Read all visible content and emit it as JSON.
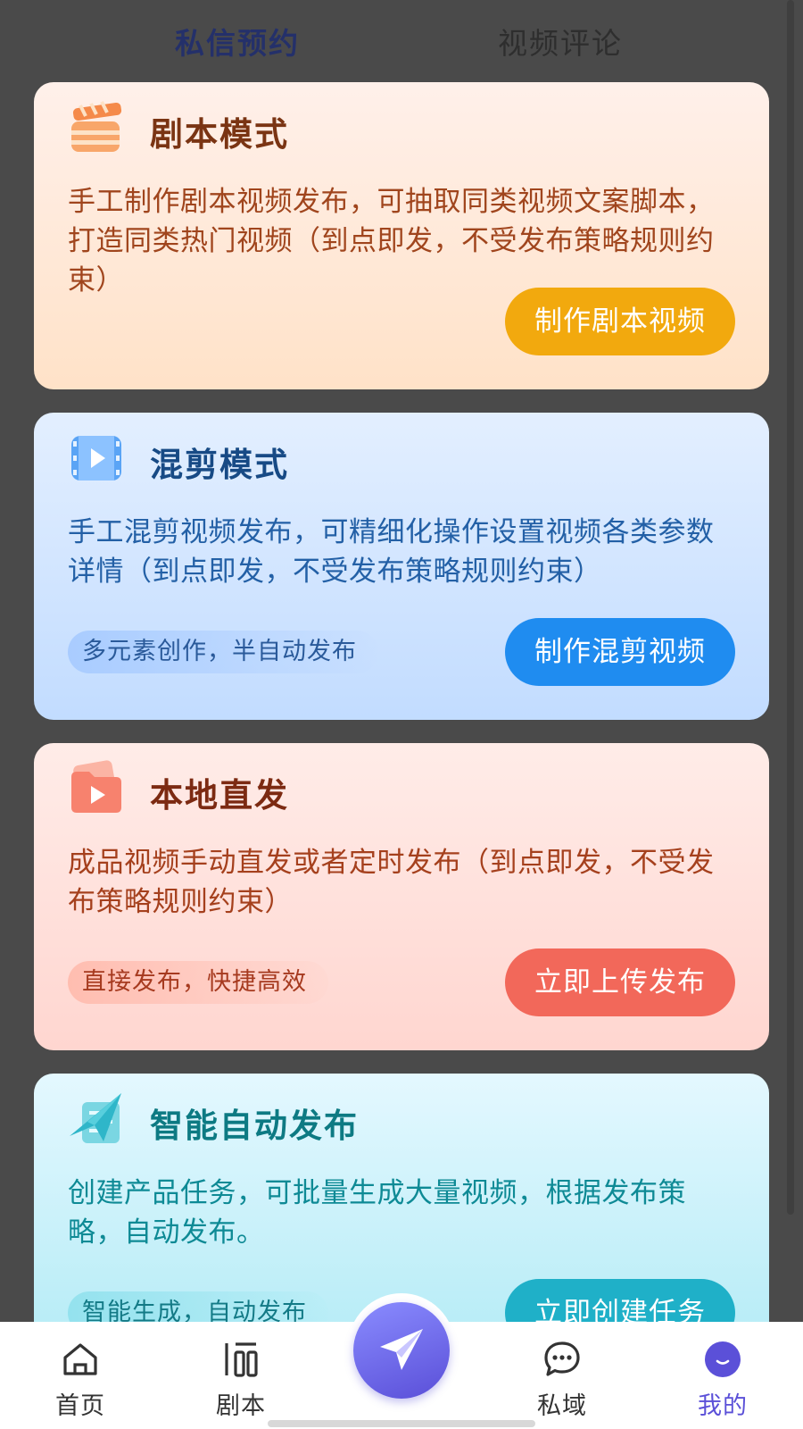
{
  "tabs": {
    "active": "私信预约",
    "inactive": "视频评论"
  },
  "cards": [
    {
      "title": "剧本模式",
      "description": "手工制作剧本视频发布，可抽取同类视频文案脚本，打造同类热门视频（到点即发，不受发布策略规则约束）",
      "button": "制作剧本视频",
      "icon": "clapperboard-icon",
      "accent": "#f2a90e"
    },
    {
      "title": "混剪模式",
      "description": "手工混剪视频发布，可精细化操作设置视频各类参数详情（到点即发，不受发布策略规则约束）",
      "tag": "多元素创作，半自动发布",
      "button": "制作混剪视频",
      "icon": "film-strip-icon",
      "accent": "#1f8cf0"
    },
    {
      "title": "本地直发",
      "description": "成品视频手动直发或者定时发布（到点即发，不受发布策略规则约束）",
      "tag": "直接发布，快捷高效",
      "button": "立即上传发布",
      "icon": "folder-play-icon",
      "accent": "#f2685a"
    },
    {
      "title": "智能自动发布",
      "description": "创建产品任务，可批量生成大量视频，根据发布策略，自动发布。",
      "tag": "智能生成，自动发布",
      "button": "立即创建任务",
      "icon": "paper-plane-doc-icon",
      "accent": "#1fb0c8"
    }
  ],
  "nav": {
    "home": "首页",
    "script": "剧本",
    "private": "私域",
    "mine": "我的",
    "active_color": "#5b50d8"
  }
}
